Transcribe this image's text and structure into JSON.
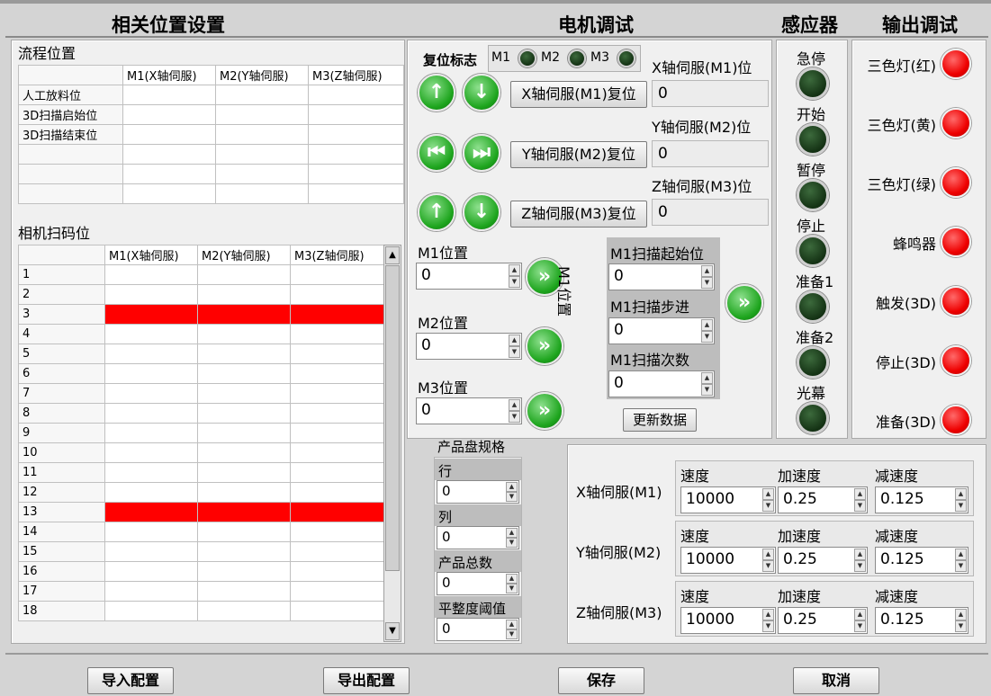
{
  "headers": {
    "position_setup": "相关位置设置",
    "motor_debug": "电机调试",
    "sensor": "感应器",
    "output_debug": "输出调试"
  },
  "flow": {
    "title": "流程位置",
    "columns": [
      "M1(X轴伺服)",
      "M2(Y轴伺服)",
      "M3(Z轴伺服)"
    ],
    "rows": [
      "人工放料位",
      "3D扫描启始位",
      "3D扫描结束位",
      "",
      "",
      ""
    ]
  },
  "scan": {
    "title": "相机扫码位",
    "columns": [
      "M1(X轴伺服)",
      "M2(Y轴伺服)",
      "M3(Z轴伺服)"
    ],
    "rows": [
      "1",
      "2",
      "3",
      "4",
      "5",
      "6",
      "7",
      "8",
      "9",
      "10",
      "11",
      "12",
      "13",
      "14",
      "15",
      "16",
      "17",
      "18"
    ],
    "highlighted_rows": [
      "3",
      "13"
    ],
    "highlight_color": "#ff0000"
  },
  "motor": {
    "reset_flag": "复位标志",
    "reset_leds": [
      "M1",
      "M2",
      "M3"
    ],
    "x_pos_label": "X轴伺服(M1)位",
    "x_pos_value": "0",
    "x_reset": "X轴伺服(M1)复位",
    "y_pos_label": "Y轴伺服(M2)位",
    "y_pos_value": "0",
    "y_reset": "Y轴伺服(M2)复位",
    "z_pos_label": "Z轴伺服(M3)位",
    "z_pos_value": "0",
    "z_reset": "Z轴伺服(M3)复位",
    "m1_pos_label": "M1位置",
    "m1_pos_value": "0",
    "m2_pos_label": "M2位置",
    "m2_pos_value": "0",
    "m3_pos_label": "M3位置",
    "m3_pos_value": "0",
    "m1_vertical_label": "M1位置",
    "scan_start_label": "M1扫描起始位",
    "scan_start_value": "0",
    "scan_step_label": "M1扫描步进",
    "scan_step_value": "0",
    "scan_count_label": "M1扫描次数",
    "scan_count_value": "0",
    "update_button": "更新数据"
  },
  "sensors": [
    "急停",
    "开始",
    "暂停",
    "停止",
    "准备1",
    "准备2",
    "光幕"
  ],
  "outputs": [
    "三色灯(红)",
    "三色灯(黄)",
    "三色灯(绿)",
    "蜂鸣器",
    "触发(3D)",
    "停止(3D)",
    "准备(3D)"
  ],
  "tray": {
    "title": "产品盘规格",
    "fields": [
      {
        "label": "行",
        "value": "0"
      },
      {
        "label": "列",
        "value": "0"
      },
      {
        "label": "产品总数",
        "value": "0"
      },
      {
        "label": "平整度阈值",
        "value": "0"
      }
    ]
  },
  "servo": {
    "speed_label": "速度",
    "accel_label": "加速度",
    "decel_label": "减速度",
    "axes": [
      {
        "name": "X轴伺服(M1)",
        "speed": "10000",
        "accel": "0.25",
        "decel": "0.125"
      },
      {
        "name": "Y轴伺服(M2)",
        "speed": "10000",
        "accel": "0.25",
        "decel": "0.125"
      },
      {
        "name": "Z轴伺服(M3)",
        "speed": "10000",
        "accel": "0.25",
        "decel": "0.125"
      }
    ]
  },
  "bottom": {
    "import": "导入配置",
    "export": "导出配置",
    "save": "保存",
    "cancel": "取消"
  },
  "colors": {
    "led_on_red": "#ff0000",
    "led_off_green": "#143214",
    "button_green": "#1ea51e"
  }
}
